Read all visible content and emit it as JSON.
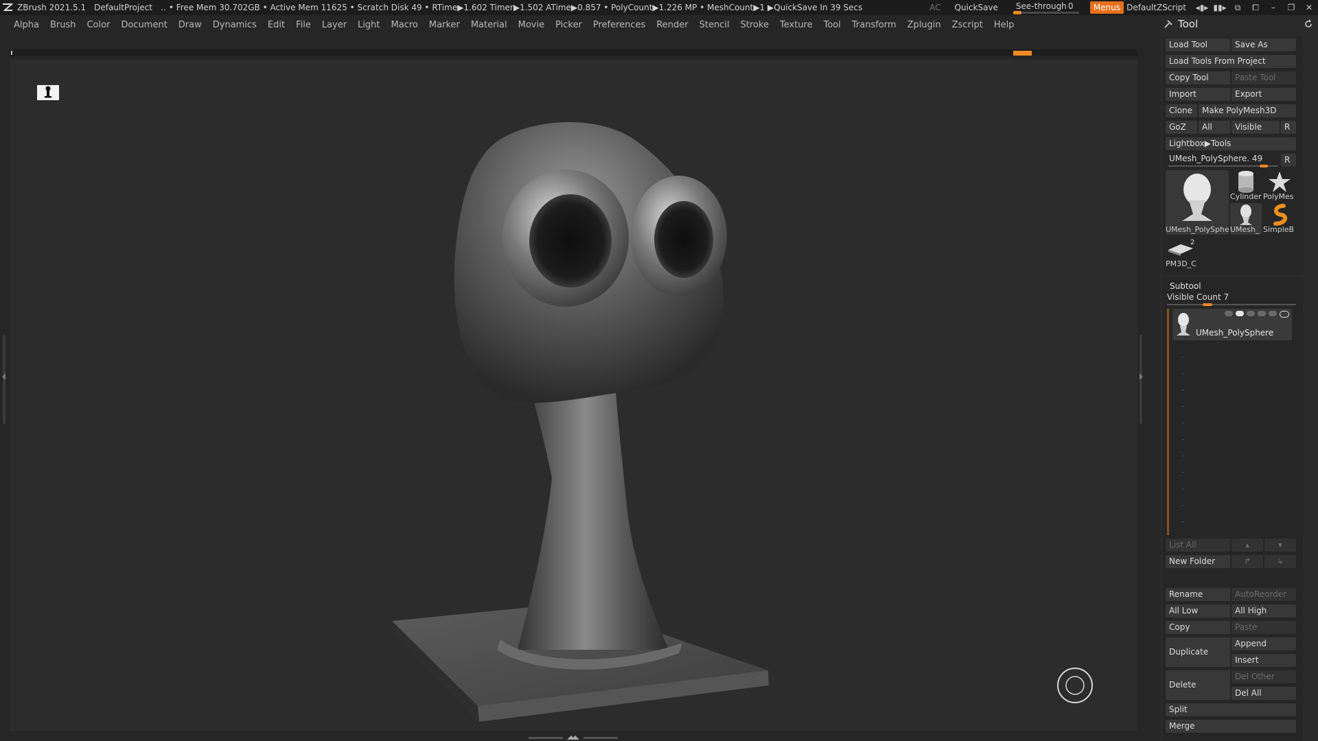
{
  "titlebar": {
    "app": "ZBrush 2021.5.1",
    "project": "DefaultProject",
    "stats": "‥ • Free Mem 30.702GB • Active Mem 11625 • Scratch Disk 49 •  RTime▶1.602 Timer▶1.502 ATime▶0.857 • PolyCount▶1.226 MP  • MeshCount▶1  ▶QuickSave In 39 Secs",
    "ac": "AC",
    "quicksave": "QuickSave",
    "see_through_label": "See-through",
    "see_through_value": "0",
    "see_through_level": 0,
    "menus": "Menus",
    "zscript": "DefaultZScript"
  },
  "menubar": [
    "Alpha",
    "Brush",
    "Color",
    "Document",
    "Draw",
    "Dynamics",
    "Edit",
    "File",
    "Layer",
    "Light",
    "Macro",
    "Marker",
    "Material",
    "Movie",
    "Picker",
    "Preferences",
    "Render",
    "Stencil",
    "Stroke",
    "Texture",
    "Tool",
    "Transform",
    "Zplugin",
    "Zscript",
    "Help"
  ],
  "icons": {
    "app_logo": "zbrush-logo-icon",
    "persp": "perspective-icon",
    "nav": "navigation-circle-icon",
    "pin": "pin-icon",
    "refresh": "refresh-icon"
  },
  "colors": {
    "accent": "#f08a24",
    "panel": "#2a2a2a",
    "viewport": "#2c2c2c",
    "button": "#383838"
  },
  "tool": {
    "title": "Tool",
    "load_tool": "Load Tool",
    "save_as": "Save As",
    "load_from_project": "Load Tools From Project",
    "copy_tool": "Copy Tool",
    "paste_tool": "Paste Tool",
    "import": "Import",
    "export": "Export",
    "clone": "Clone",
    "make_polymesh": "Make PolyMesh3D",
    "goz": "GoZ",
    "all": "All",
    "visible": "Visible",
    "r": "R",
    "lightbox": "Lightbox▶Tools",
    "current_tool": "UMesh_PolySphere. 49",
    "current_tool_slider": 0.9,
    "thumbs": {
      "main": "UMesh_PolySphe",
      "cylinder": "Cylinder",
      "polymesh": "PolyMes",
      "umesh_small": "UMesh_",
      "simpleb": "SimpleB",
      "pm3d": "PM3D_C",
      "pm3d_badge": "2"
    }
  },
  "subtool": {
    "title": "Subtool",
    "visible_count": "Visible Count 7",
    "visible_count_level": 0.3,
    "item": "UMesh_PolySphere",
    "list_all": "List All",
    "new_folder": "New Folder",
    "rename": "Rename",
    "autoreorder": "AutoReorder",
    "all_low": "All Low",
    "all_high": "All High",
    "copy": "Copy",
    "paste": "Paste",
    "duplicate": "Duplicate",
    "append": "Append",
    "insert": "Insert",
    "delete": "Delete",
    "del_other": "Del Other",
    "del_all": "Del All",
    "split": "Split",
    "merge": "Merge"
  }
}
